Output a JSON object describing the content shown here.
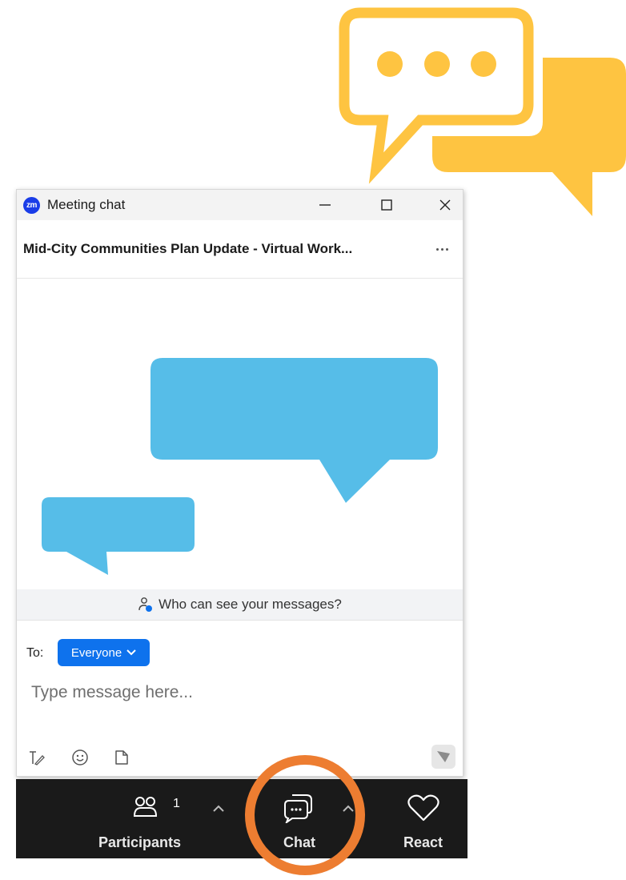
{
  "window": {
    "app_logo_text": "zm",
    "title": "Meeting chat"
  },
  "meeting": {
    "title": "Mid-City Communities Plan Update - Virtual Work..."
  },
  "chat": {
    "visibility_prompt": "Who can see your messages?",
    "to_label": "To:",
    "recipient": "Everyone",
    "input_placeholder": "Type message here..."
  },
  "toolbar": {
    "participants_label": "Participants",
    "participants_count": "1",
    "chat_label": "Chat",
    "react_label": "React"
  },
  "colors": {
    "deco_bubble": "#fec441",
    "message_bubble": "#56bde8",
    "accent_blue": "#0e72ed",
    "highlight": "#ed7d31",
    "toolbar_bg": "#1a1a1a"
  },
  "icons": [
    "chat-bubbles-icon",
    "minimize-icon",
    "maximize-icon",
    "close-icon",
    "more-icon",
    "people-lock-icon",
    "chevron-down-icon",
    "format-text-icon",
    "emoji-icon",
    "file-icon",
    "send-icon",
    "participants-icon",
    "chevron-up-icon",
    "chat-icon",
    "heart-icon"
  ]
}
